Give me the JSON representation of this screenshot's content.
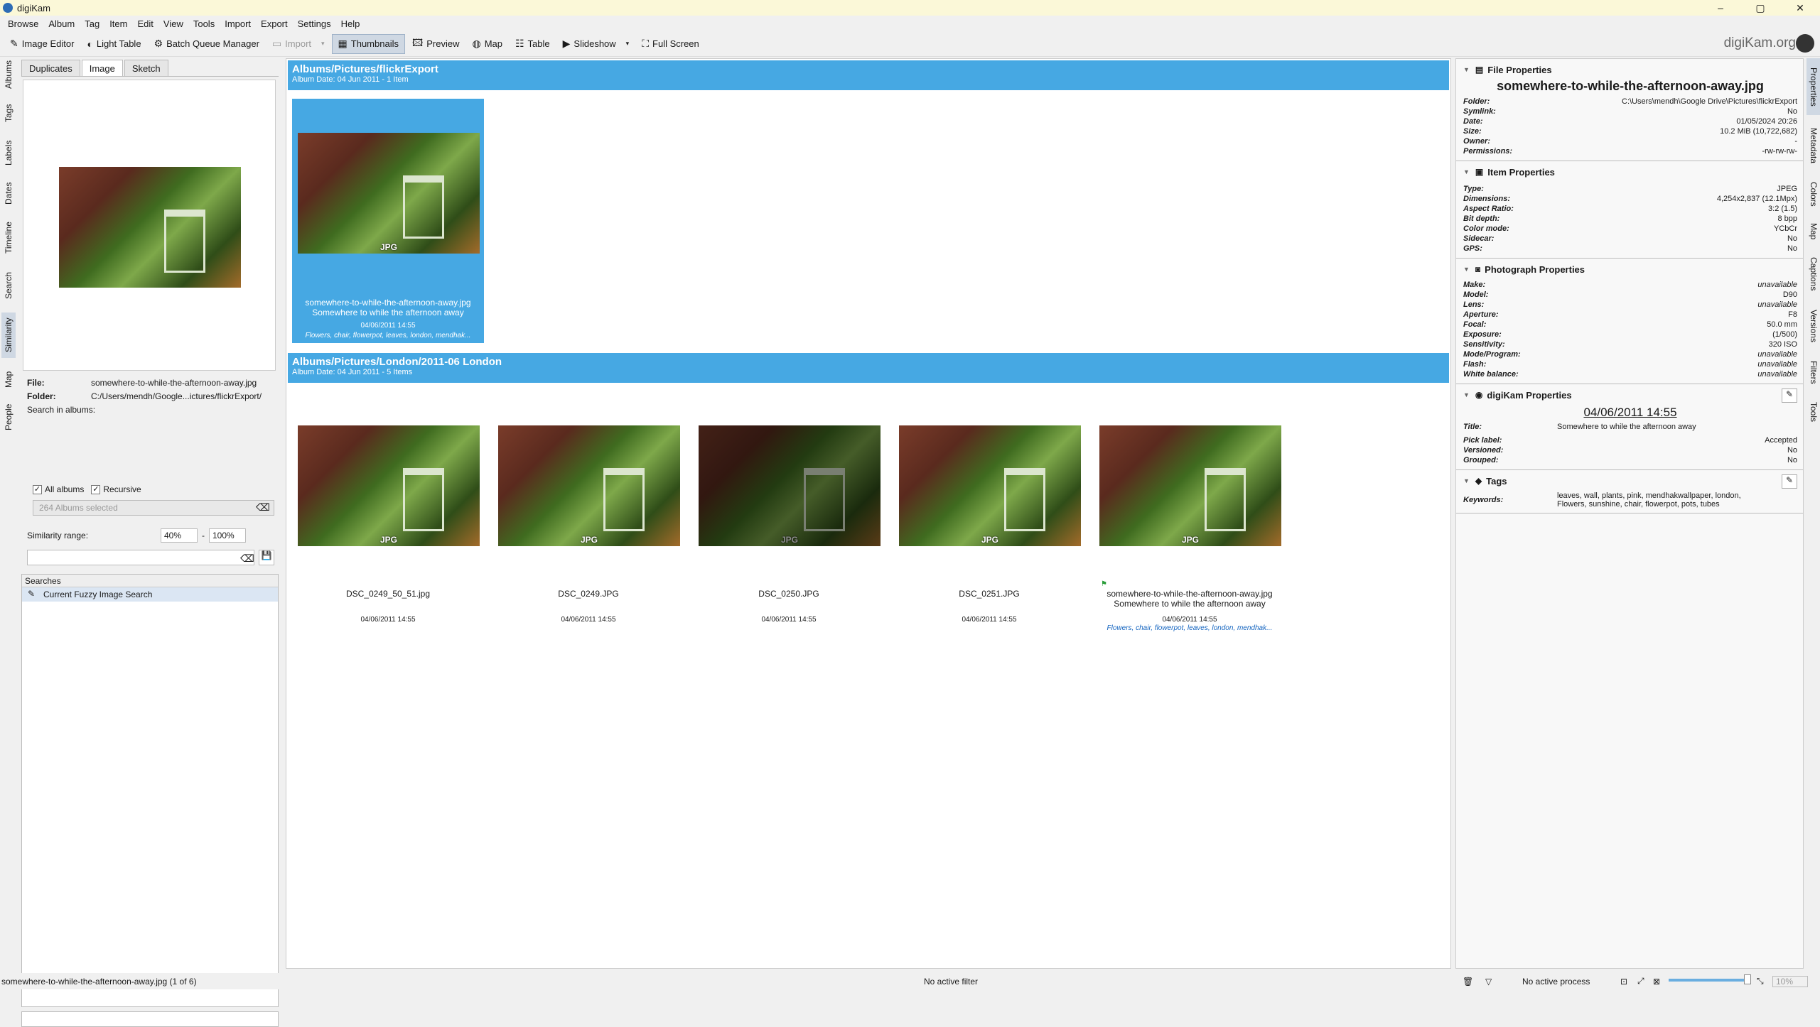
{
  "window": {
    "title": "digiKam",
    "minimize": "–",
    "maximize": "▢",
    "close": "✕"
  },
  "menu": [
    "Browse",
    "Album",
    "Tag",
    "Item",
    "Edit",
    "View",
    "Tools",
    "Import",
    "Export",
    "Settings",
    "Help"
  ],
  "toolbar": {
    "image_editor": "Image Editor",
    "light_table": "Light Table",
    "batch_queue": "Batch Queue Manager",
    "import": "Import",
    "thumbnails": "Thumbnails",
    "preview": "Preview",
    "map": "Map",
    "table": "Table",
    "slideshow": "Slideshow",
    "full_screen": "Full Screen",
    "brand": "digiKam.org"
  },
  "left_tabs": [
    "Albums",
    "Tags",
    "Labels",
    "Dates",
    "Timeline",
    "Search",
    "Similarity",
    "Map",
    "People"
  ],
  "right_tabs": [
    "Properties",
    "Metadata",
    "Colors",
    "Map",
    "Captions",
    "Versions",
    "Filters",
    "Tools"
  ],
  "similarity": {
    "tabs": [
      "Duplicates",
      "Image",
      "Sketch"
    ],
    "file_label": "File:",
    "file_value": "somewhere-to-while-the-afternoon-away.jpg",
    "folder_label": "Folder:",
    "folder_value": "C:/Users/mendh/Google...ictures/flickrExport/",
    "search_in": "Search in albums:",
    "all_albums": "All albums",
    "recursive": "Recursive",
    "albums_selected": "264 Albums selected",
    "range_label": "Similarity range:",
    "range_min": "40%",
    "range_sep": "-",
    "range_max": "100%",
    "searches_header": "Searches",
    "search_item": "Current Fuzzy Image Search"
  },
  "groups": [
    {
      "title": "Albums/Pictures/flickrExport",
      "subtitle": "Album Date: 04 Jun 2011 - 1 Item"
    },
    {
      "title": "Albums/Pictures/London/2011-06 London",
      "subtitle": "Album Date: 04 Jun 2011 - 5 Items"
    }
  ],
  "selected_thumb": {
    "name": "somewhere-to-while-the-afternoon-away.jpg",
    "title": "Somewhere to while the afternoon away",
    "date": "04/06/2011 14:55",
    "tags": "Flowers, chair, flowerpot, leaves, london, mendhak...",
    "badge": "JPG"
  },
  "thumbs": [
    {
      "name": "DSC_0249_50_51.jpg",
      "date": "04/06/2011 14:55",
      "title": "",
      "tags": "",
      "badge": "JPG"
    },
    {
      "name": "DSC_0249.JPG",
      "date": "04/06/2011 14:55",
      "title": "",
      "tags": "",
      "badge": "JPG"
    },
    {
      "name": "DSC_0250.JPG",
      "date": "04/06/2011 14:55",
      "title": "",
      "tags": "",
      "badge": "JPG"
    },
    {
      "name": "DSC_0251.JPG",
      "date": "04/06/2011 14:55",
      "title": "",
      "tags": "",
      "badge": "JPG"
    },
    {
      "name": "somewhere-to-while-the-afternoon-away.jpg",
      "date": "04/06/2011 14:55",
      "title": "Somewhere to while the afternoon away",
      "tags": "Flowers, chair, flowerpot, leaves, london, mendhak...",
      "badge": "JPG"
    }
  ],
  "properties": {
    "file_header": "File Properties",
    "filename": "somewhere-to-while-the-afternoon-away.jpg",
    "file": [
      {
        "k": "Folder:",
        "v": "C:\\Users\\mendh\\Google Drive\\Pictures\\flickrExport"
      },
      {
        "k": "Symlink:",
        "v": "No"
      },
      {
        "k": "Date:",
        "v": "01/05/2024 20:26"
      },
      {
        "k": "Size:",
        "v": "10.2 MiB (10,722,682)"
      },
      {
        "k": "Owner:",
        "v": "-"
      },
      {
        "k": "Permissions:",
        "v": "-rw-rw-rw-"
      }
    ],
    "item_header": "Item Properties",
    "item": [
      {
        "k": "Type:",
        "v": "JPEG"
      },
      {
        "k": "Dimensions:",
        "v": "4,254x2,837 (12.1Mpx)"
      },
      {
        "k": "Aspect Ratio:",
        "v": "3:2 (1.5)"
      },
      {
        "k": "Bit depth:",
        "v": "8 bpp"
      },
      {
        "k": "Color mode:",
        "v": "YCbCr"
      },
      {
        "k": "Sidecar:",
        "v": "No"
      },
      {
        "k": "GPS:",
        "v": "No"
      }
    ],
    "photo_header": "Photograph Properties",
    "photo": [
      {
        "k": "Make:",
        "v": "unavailable"
      },
      {
        "k": "Model:",
        "v": "D90"
      },
      {
        "k": "Lens:",
        "v": "unavailable"
      },
      {
        "k": "Aperture:",
        "v": "F8"
      },
      {
        "k": "Focal:",
        "v": "50.0 mm"
      },
      {
        "k": "Exposure:",
        "v": "(1/500)"
      },
      {
        "k": "Sensitivity:",
        "v": "320 ISO"
      },
      {
        "k": "Mode/Program:",
        "v": "unavailable"
      },
      {
        "k": "Flash:",
        "v": "unavailable"
      },
      {
        "k": "White balance:",
        "v": "unavailable"
      }
    ],
    "digikam_header": "digiKam Properties",
    "digikam_date": "04/06/2011 14:55",
    "title_label": "Title:",
    "title_value": "Somewhere to while the afternoon away",
    "digikam": [
      {
        "k": "Pick label:",
        "v": "Accepted"
      },
      {
        "k": "Versioned:",
        "v": "No"
      },
      {
        "k": "Grouped:",
        "v": "No"
      }
    ],
    "tags_header": "Tags",
    "keywords_label": "Keywords:",
    "keywords_value": "leaves, wall, plants, pink, mendhakwallpaper, london, Flowers, sunshine, chair, flowerpot, pots, tubes"
  },
  "status": {
    "left": "somewhere-to-while-the-afternoon-away.jpg (1 of 6)",
    "filter": "No active filter",
    "process": "No active process",
    "zoom": "10%"
  },
  "colors": {
    "accent": "#46a8e3",
    "titlebar": "#fbf8d8"
  }
}
